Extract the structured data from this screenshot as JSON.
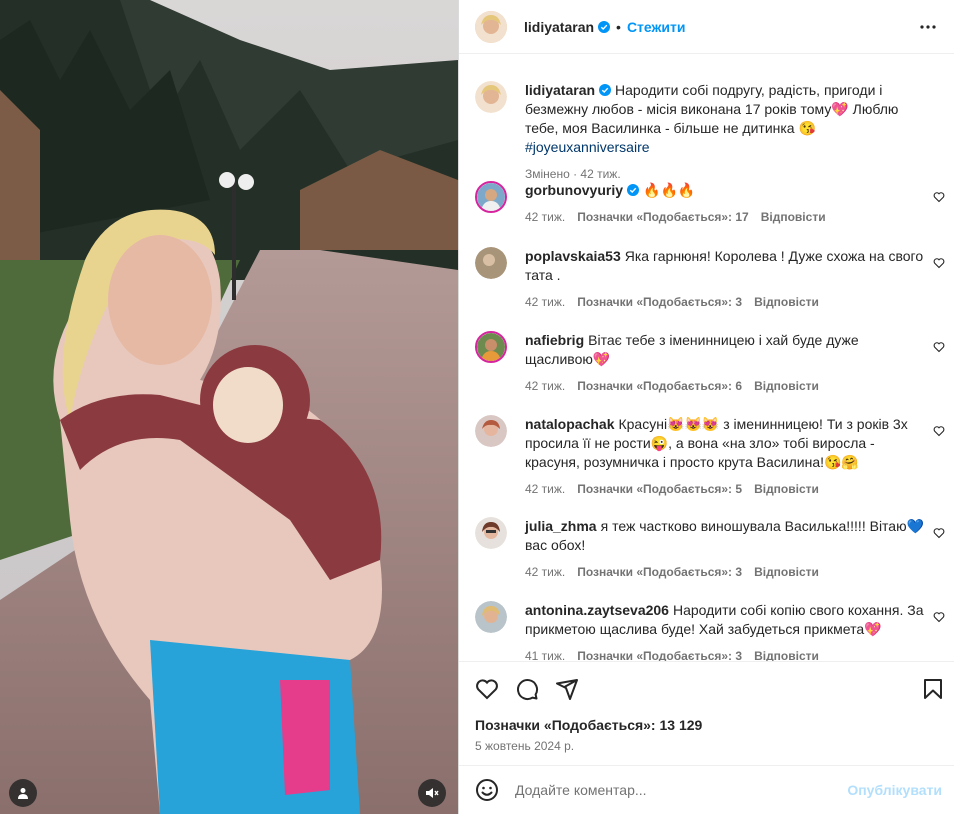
{
  "post": {
    "author": "lidiyataran",
    "follow_label": "Стежити",
    "caption": "Народити собі подругу, радість, пригоди і безмежну любов - місія виконана 17 років тому💖 Люблю тебе, моя Василинка - більше не дитинка 😘 ",
    "hashtag": "#joyeuxanniversaire",
    "caption_meta": "Змінено · 42 тиж.",
    "likes": "Позначки «Подобається»: 13 129",
    "date": "5 жовтень 2024 р."
  },
  "comments": [
    {
      "user": "gorbunovyuriy",
      "verified": true,
      "text": "🔥🔥🔥",
      "time": "42 тиж.",
      "likes": "Позначки «Подобається»: 17",
      "reply": "Відповісти"
    },
    {
      "user": "poplavskaia53",
      "text": "Яка гарнюня! Королева ! Дуже схожа на свого тата .",
      "time": "42 тиж.",
      "likes": "Позначки «Подобається»: 3",
      "reply": "Відповісти"
    },
    {
      "user": "nafiebrig",
      "text": "Вітає тебе з іменинницею і хай буде дуже щасливою💖",
      "time": "42 тиж.",
      "likes": "Позначки «Подобається»: 6",
      "reply": "Відповісти"
    },
    {
      "user": "natalopachak",
      "text": "Красуні😻😻😻 з іменинницею! Ти з років 3х просила її не рости😜, а вона «на зло» тобі виросла - красуня, розумничка і просто крута Василина!😘🤗",
      "time": "42 тиж.",
      "likes": "Позначки «Подобається»: 5",
      "reply": "Відповісти"
    },
    {
      "user": "julia_zhma",
      "text": "я теж частково виношувала Василька!!!!! Вітаю💙вас обох!",
      "time": "42 тиж.",
      "likes": "Позначки «Подобається»: 3",
      "reply": "Відповісти"
    },
    {
      "user": "antonina.zaytseva206",
      "text": "Народити собі копію свого кохання. За прикметою щаслива буде! Хай забудеться прикмета💖",
      "time": "41 тиж.",
      "likes": "Позначки «Подобається»: 3",
      "reply": "Відповісти"
    }
  ],
  "add_comment": {
    "placeholder": "Додайте коментар...",
    "post_label": "Опублікувати"
  },
  "icons": [
    "verified-icon",
    "more-icon",
    "heart-icon",
    "comment-icon",
    "share-icon",
    "bookmark-icon",
    "emoji-icon",
    "user-icon",
    "mute-icon"
  ],
  "colors": {
    "link": "#0095f6",
    "post_disabled": "#b2dffc",
    "muted": "#737373"
  }
}
